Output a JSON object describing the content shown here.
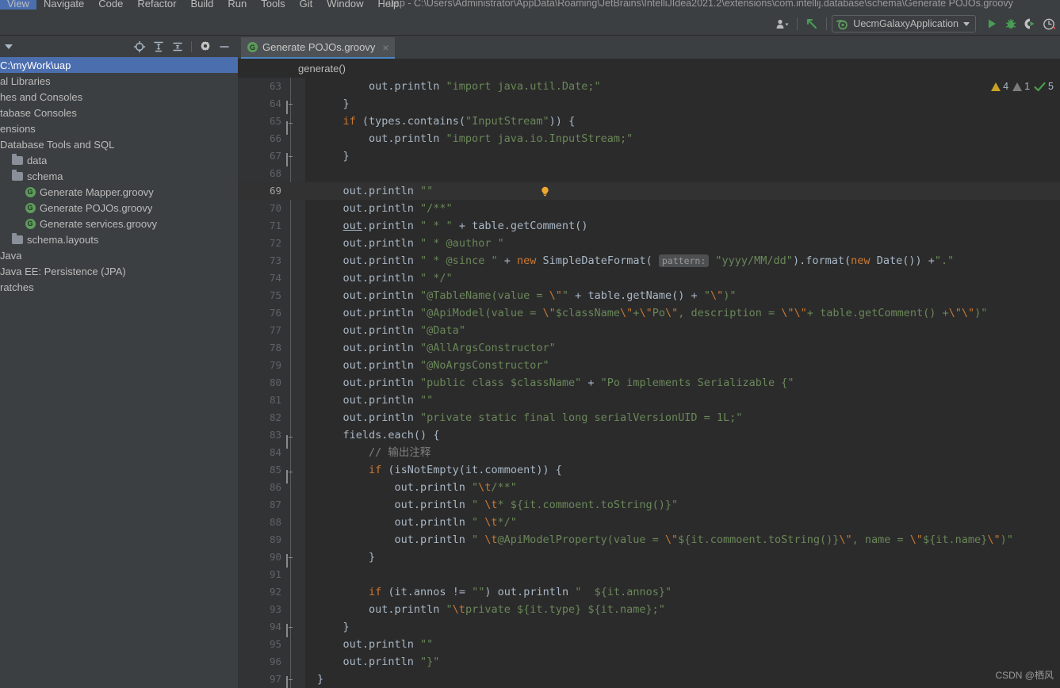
{
  "window": {
    "title": "uap - C:\\Users\\Administrator\\AppData\\Roaming\\JetBrains\\IntelliJIdea2021.2\\extensions\\com.intellij.database\\schema\\Generate POJOs.groovy"
  },
  "menubar": {
    "items": [
      "View",
      "Navigate",
      "Code",
      "Refactor",
      "Build",
      "Run",
      "Tools",
      "Git",
      "Window",
      "Help"
    ]
  },
  "toolbar": {
    "run_config": "UecmGalaxyApplication",
    "icons": [
      "user-icon",
      "update-project-icon",
      "run-icon",
      "debug-icon",
      "run-coverage-icon",
      "profiler-icon"
    ]
  },
  "project_panel": {
    "icons": [
      "select-opened-file-icon",
      "expand-all-icon",
      "collapse-all-icon",
      "settings-gear-icon",
      "hide-panel-icon"
    ],
    "tree": [
      {
        "label": "C:\\myWork\\uap",
        "indent": 0,
        "icon": "none",
        "selected": true
      },
      {
        "label": "External Libraries",
        "indent": 0,
        "icon": "none",
        "selected": false,
        "clip": "al Libraries"
      },
      {
        "label": "Scratches and Consoles",
        "indent": 0,
        "icon": "none",
        "selected": false,
        "clip": "hes and Consoles"
      },
      {
        "label": "Database Consoles",
        "indent": 0,
        "icon": "none",
        "selected": false,
        "clip": "tabase Consoles"
      },
      {
        "label": "Extensions",
        "indent": 0,
        "icon": "none",
        "selected": false,
        "clip": "ensions"
      },
      {
        "label": "Database Tools and SQL",
        "indent": 1,
        "icon": "none",
        "selected": false,
        "clip": "Database Tools and SQL"
      },
      {
        "label": "data",
        "indent": 2,
        "icon": "folder",
        "selected": false
      },
      {
        "label": "schema",
        "indent": 2,
        "icon": "folder",
        "selected": false
      },
      {
        "label": "Generate Mapper.groovy",
        "indent": 3,
        "icon": "groovy",
        "selected": false
      },
      {
        "label": "Generate POJOs.groovy",
        "indent": 3,
        "icon": "groovy",
        "selected": false
      },
      {
        "label": "Generate services.groovy",
        "indent": 3,
        "icon": "groovy",
        "selected": false
      },
      {
        "label": "schema.layouts",
        "indent": 2,
        "icon": "folder",
        "selected": false
      },
      {
        "label": "Java",
        "indent": 1,
        "icon": "none",
        "selected": false,
        "clip": "Java"
      },
      {
        "label": "Java EE: Persistence (JPA)",
        "indent": 1,
        "icon": "none",
        "selected": false,
        "clip": "Java EE: Persistence (JPA)"
      },
      {
        "label": "Scratches",
        "indent": 0,
        "icon": "none",
        "selected": false,
        "clip": "ratches"
      }
    ]
  },
  "editor": {
    "tab": {
      "label": "Generate POJOs.groovy",
      "icon": "groovy-file-icon",
      "close": "×"
    },
    "breadcrumb": "generate()",
    "inspections": {
      "warnings": "4",
      "weak_warnings": "1",
      "checks": "5"
    },
    "current_line": 69,
    "lines": [
      {
        "n": 63,
        "indent": 8,
        "fold": "none"
      },
      {
        "n": 64,
        "indent": 4,
        "fold": "end"
      },
      {
        "n": 65,
        "indent": 4,
        "fold": "start"
      },
      {
        "n": 66,
        "indent": 8,
        "fold": "none"
      },
      {
        "n": 67,
        "indent": 4,
        "fold": "end"
      },
      {
        "n": 68,
        "indent": 0,
        "fold": "none"
      },
      {
        "n": 69,
        "indent": 4,
        "fold": "none",
        "bulb": true
      },
      {
        "n": 70,
        "indent": 4,
        "fold": "none"
      },
      {
        "n": 71,
        "indent": 4,
        "fold": "none"
      },
      {
        "n": 72,
        "indent": 4,
        "fold": "none"
      },
      {
        "n": 73,
        "indent": 4,
        "fold": "none"
      },
      {
        "n": 74,
        "indent": 4,
        "fold": "none"
      },
      {
        "n": 75,
        "indent": 4,
        "fold": "none"
      },
      {
        "n": 76,
        "indent": 4,
        "fold": "none"
      },
      {
        "n": 77,
        "indent": 4,
        "fold": "none"
      },
      {
        "n": 78,
        "indent": 4,
        "fold": "none"
      },
      {
        "n": 79,
        "indent": 4,
        "fold": "none"
      },
      {
        "n": 80,
        "indent": 4,
        "fold": "none"
      },
      {
        "n": 81,
        "indent": 4,
        "fold": "none"
      },
      {
        "n": 82,
        "indent": 4,
        "fold": "none"
      },
      {
        "n": 83,
        "indent": 4,
        "fold": "start"
      },
      {
        "n": 84,
        "indent": 8,
        "fold": "none"
      },
      {
        "n": 85,
        "indent": 8,
        "fold": "start"
      },
      {
        "n": 86,
        "indent": 12,
        "fold": "none"
      },
      {
        "n": 87,
        "indent": 12,
        "fold": "none"
      },
      {
        "n": 88,
        "indent": 12,
        "fold": "none"
      },
      {
        "n": 89,
        "indent": 12,
        "fold": "none"
      },
      {
        "n": 90,
        "indent": 8,
        "fold": "end"
      },
      {
        "n": 91,
        "indent": 0,
        "fold": "none"
      },
      {
        "n": 92,
        "indent": 8,
        "fold": "none"
      },
      {
        "n": 93,
        "indent": 8,
        "fold": "none"
      },
      {
        "n": 94,
        "indent": 4,
        "fold": "end"
      },
      {
        "n": 95,
        "indent": 4,
        "fold": "none"
      },
      {
        "n": 96,
        "indent": 4,
        "fold": "none"
      },
      {
        "n": 97,
        "indent": 0,
        "fold": "end"
      }
    ],
    "code_text": [
      "        out.println \"import java.util.Date;\"",
      "    }",
      "    if (types.contains(\"InputStream\")) {",
      "        out.println \"import java.io.InputStream;\"",
      "    }",
      "",
      "    out.println \"\"",
      "    out.println \"/**\"",
      "    out.println \" * \" + table.getComment()",
      "    out.println \" * @author \"",
      "    out.println \" * @since \" + new SimpleDateFormat( pattern: \"yyyy/MM/dd\").format(new Date()) +\".\"",
      "    out.println \" */\"",
      "    out.println \"@TableName(value = \\\"\" + table.getName() + \"\\\")\"",
      "    out.println \"@ApiModel(value = \\\"$className\\\"+\\\"Po\\\", description = \\\"\\\"+ table.getComment() +\\\"\\\")\"",
      "    out.println \"@Data\"",
      "    out.println \"@AllArgsConstructor\"",
      "    out.println \"@NoArgsConstructor\"",
      "    out.println \"public class $className\" + \"Po implements Serializable {\"",
      "    out.println \"\"",
      "    out.println \"private static final long serialVersionUID = 1L;\"",
      "    fields.each() {",
      "        // 输出注释",
      "        if (isNotEmpty(it.commoent)) {",
      "            out.println \"\\t/**\"",
      "            out.println \" \\t* ${it.commoent.toString()}\"",
      "            out.println \" \\t*/\"",
      "            out.println \" \\t@ApiModelProperty(value = \\\"${it.commoent.toString()}\\\", name = \\\"${it.name}\\\")\"",
      "        }",
      "",
      "        if (it.annos != \"\") out.println \"  ${it.annos}\"",
      "        out.println \"\\tprivate ${it.type} ${it.name};\"",
      "    }",
      "    out.println \"\"",
      "    out.println \"}\"",
      "}"
    ]
  },
  "watermark": "CSDN @栖风",
  "colors": {
    "accent_blue": "#4b6eaf",
    "editor_bg": "#2b2b2b",
    "panel_bg": "#3c3f41",
    "gutter_bg": "#313335",
    "string_green": "#6a8759",
    "keyword_orange": "#cc7832",
    "text_default": "#a9b7c6",
    "warning_yellow": "#c9a227",
    "run_green": "#499c54"
  }
}
